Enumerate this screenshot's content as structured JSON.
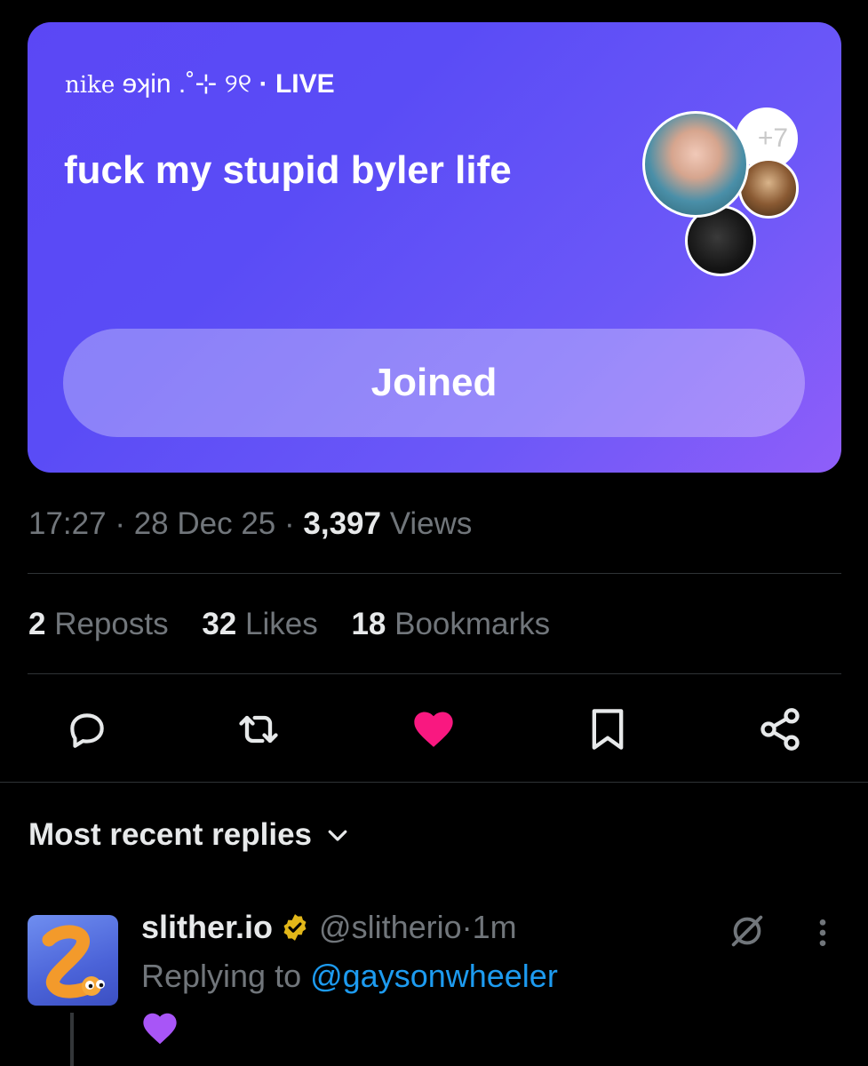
{
  "space": {
    "host_name": "nike",
    "host_suffix": "ɘʞin .˚⊹ ୨୧",
    "separator": "·",
    "status": "LIVE",
    "title": "fuck my stupid byler life",
    "extra_listeners": "+7",
    "join_label": "Joined",
    "colors": {
      "gradient_start": "#5b47f5",
      "gradient_end": "#8f5ef9"
    }
  },
  "tweet_meta": {
    "time": "17:27",
    "sep1": " · ",
    "date": "28 Dec 25",
    "sep2": " · ",
    "views_count": "3,397",
    "views_label": " Views"
  },
  "stats": [
    {
      "count": "2",
      "label": " Reposts"
    },
    {
      "count": "32",
      "label": " Likes"
    },
    {
      "count": "18",
      "label": " Bookmarks"
    }
  ],
  "actions": {
    "reply": "reply-icon",
    "repost": "repost-icon",
    "like": "heart-icon",
    "like_color": "#f91880",
    "bookmark": "bookmark-icon",
    "share": "share-icon"
  },
  "replies_filter": {
    "label": "Most recent replies"
  },
  "reply": {
    "name": "slither.io",
    "verified_color": "#e2b719",
    "handle": "@slitherio",
    "sep": " · ",
    "time": "1m",
    "replying_prefix": "Replying to ",
    "replying_to": "@gaysonwheeler",
    "body": "💜"
  }
}
